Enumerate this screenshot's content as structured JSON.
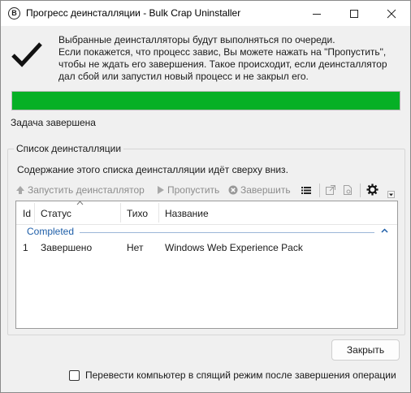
{
  "window": {
    "title": "Прогресс деинсталляции - Bulk Crap Uninstaller",
    "app_icon_letter": "B"
  },
  "message": {
    "lines": [
      "Выбранные деинсталляторы будут выполняться по очереди.",
      "Если покажется, что процесс завис, Вы можете нажать на \"Пропустить\",",
      "чтобы не ждать его завершения. Такое происходит, если деинсталлятор",
      "дал сбой или запустил новый процесс и не закрыл его."
    ]
  },
  "progress": {
    "fraction": 1.0,
    "color": "#06b025"
  },
  "task_status": "Задача завершена",
  "group": {
    "title": "Список деинсталляции",
    "description": "Содержание этого списка деинсталляции идёт сверху вниз."
  },
  "toolbar": {
    "start_label": "Запустить деинсталлятор",
    "skip_label": "Пропустить",
    "finish_label": "Завершить",
    "icons": [
      "up-arrow-icon",
      "play-arrow-icon",
      "cancel-circle-icon",
      "list-icon",
      "external-link-icon",
      "document-icon",
      "gear-icon",
      "dropdown-icon"
    ]
  },
  "table": {
    "columns": [
      "Id",
      "Статус",
      "Тихо",
      "Название"
    ],
    "groups": [
      {
        "label": "Completed",
        "rows": [
          {
            "id": "1",
            "status": "Завершено",
            "quiet": "Нет",
            "name": "Windows Web Experience Pack"
          }
        ]
      }
    ]
  },
  "close_button": "Закрыть",
  "sleep_checkbox": {
    "label": "Перевести компьютер в спящий режим после завершения операции",
    "checked": false
  }
}
